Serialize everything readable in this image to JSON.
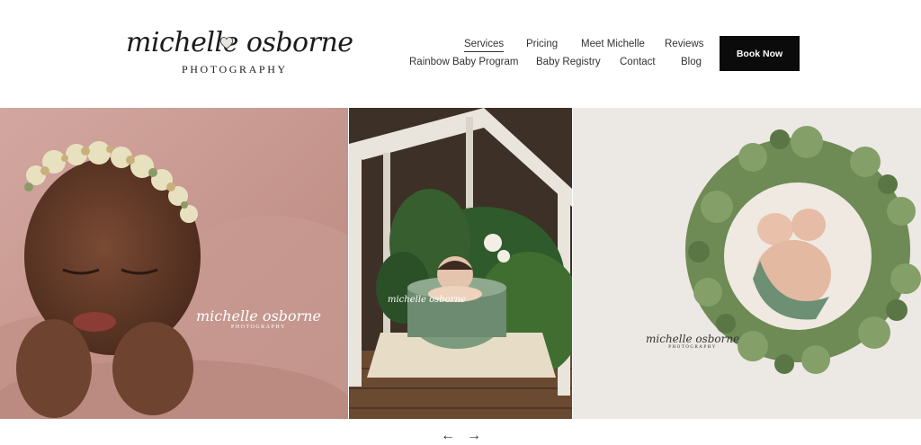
{
  "brand": {
    "logo_script": "michelle osborne",
    "logo_sub": "PHOTOGRAPHY"
  },
  "nav": {
    "row1": [
      {
        "label": "Services",
        "active": true
      },
      {
        "label": "Pricing",
        "active": false
      },
      {
        "label": "Meet Michelle",
        "active": false
      },
      {
        "label": "Reviews",
        "active": false
      }
    ],
    "row2": [
      {
        "label": "Rainbow Baby Program",
        "active": false
      },
      {
        "label": "Baby Registry",
        "active": false
      },
      {
        "label": "Contact",
        "active": false
      },
      {
        "label": "Blog",
        "active": false
      }
    ]
  },
  "cta": {
    "book_label": "Book Now"
  },
  "gallery": {
    "watermark_script": "michelle osborne",
    "watermark_sub": "PHOTOGRAPHY"
  },
  "carousel": {
    "prev_icon": "arrow-left-icon",
    "next_icon": "arrow-right-icon",
    "prev_glyph": "←",
    "next_glyph": "→"
  },
  "colors": {
    "button_bg": "#0b0b0b",
    "button_text": "#ffffff",
    "text": "#333333"
  }
}
